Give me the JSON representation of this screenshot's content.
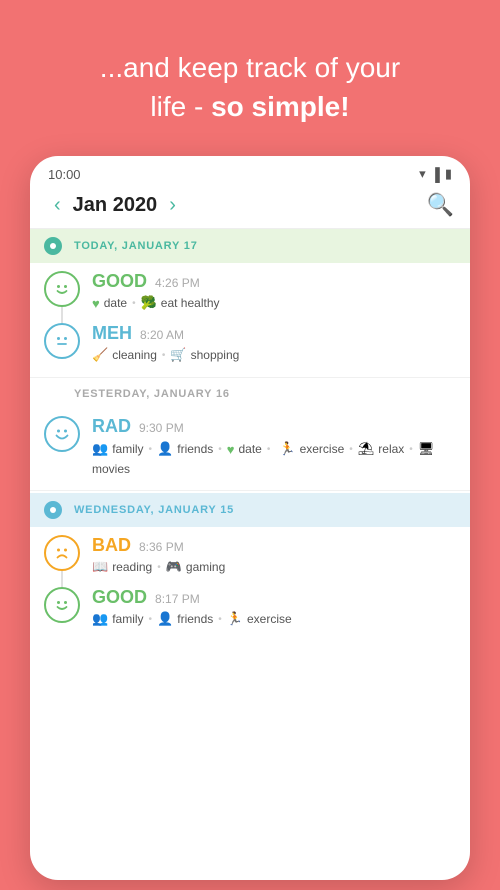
{
  "hero": {
    "text_part1": "...and keep track of your",
    "text_part2": "life - ",
    "text_bold": "so simple!"
  },
  "status_bar": {
    "time": "10:00"
  },
  "nav": {
    "prev_label": "‹",
    "next_label": "›",
    "month": "Jan 2020"
  },
  "days": [
    {
      "id": "today",
      "type": "today",
      "label": "TODAY, JANUARY 17",
      "entries": [
        {
          "mood": "good",
          "mood_label": "GOOD",
          "time": "4:26 PM",
          "tags": [
            {
              "icon": "♥",
              "label": "date"
            },
            {
              "icon": "🥦",
              "label": "eat healthy"
            }
          ]
        },
        {
          "mood": "meh",
          "mood_label": "MEH",
          "time": "8:20 AM",
          "tags": [
            {
              "icon": "🧹",
              "label": "cleaning"
            },
            {
              "icon": "🛒",
              "label": "shopping"
            }
          ]
        }
      ]
    },
    {
      "id": "yesterday",
      "type": "normal",
      "label": "YESTERDAY, JANUARY 16",
      "entries": [
        {
          "mood": "rad",
          "mood_label": "RAD",
          "time": "9:30 PM",
          "tags": [
            {
              "icon": "👥",
              "label": "family"
            },
            {
              "icon": "👤",
              "label": "friends"
            },
            {
              "icon": "♥",
              "label": "date"
            },
            {
              "icon": "🏃",
              "label": "exercise"
            },
            {
              "icon": "⛱",
              "label": "relax"
            },
            {
              "icon": "🖥",
              "label": "movies"
            }
          ]
        }
      ]
    },
    {
      "id": "wednesday",
      "type": "wednesday",
      "label": "WEDNESDAY, JANUARY 15",
      "entries": [
        {
          "mood": "bad",
          "mood_label": "BAD",
          "time": "8:36 PM",
          "tags": [
            {
              "icon": "📖",
              "label": "reading"
            },
            {
              "icon": "🎮",
              "label": "gaming"
            }
          ]
        },
        {
          "mood": "good",
          "mood_label": "GOOD",
          "time": "8:17 PM",
          "tags": [
            {
              "icon": "👥",
              "label": "family"
            },
            {
              "icon": "👤",
              "label": "friends"
            },
            {
              "icon": "🏃",
              "label": "exercise"
            }
          ]
        }
      ]
    }
  ]
}
